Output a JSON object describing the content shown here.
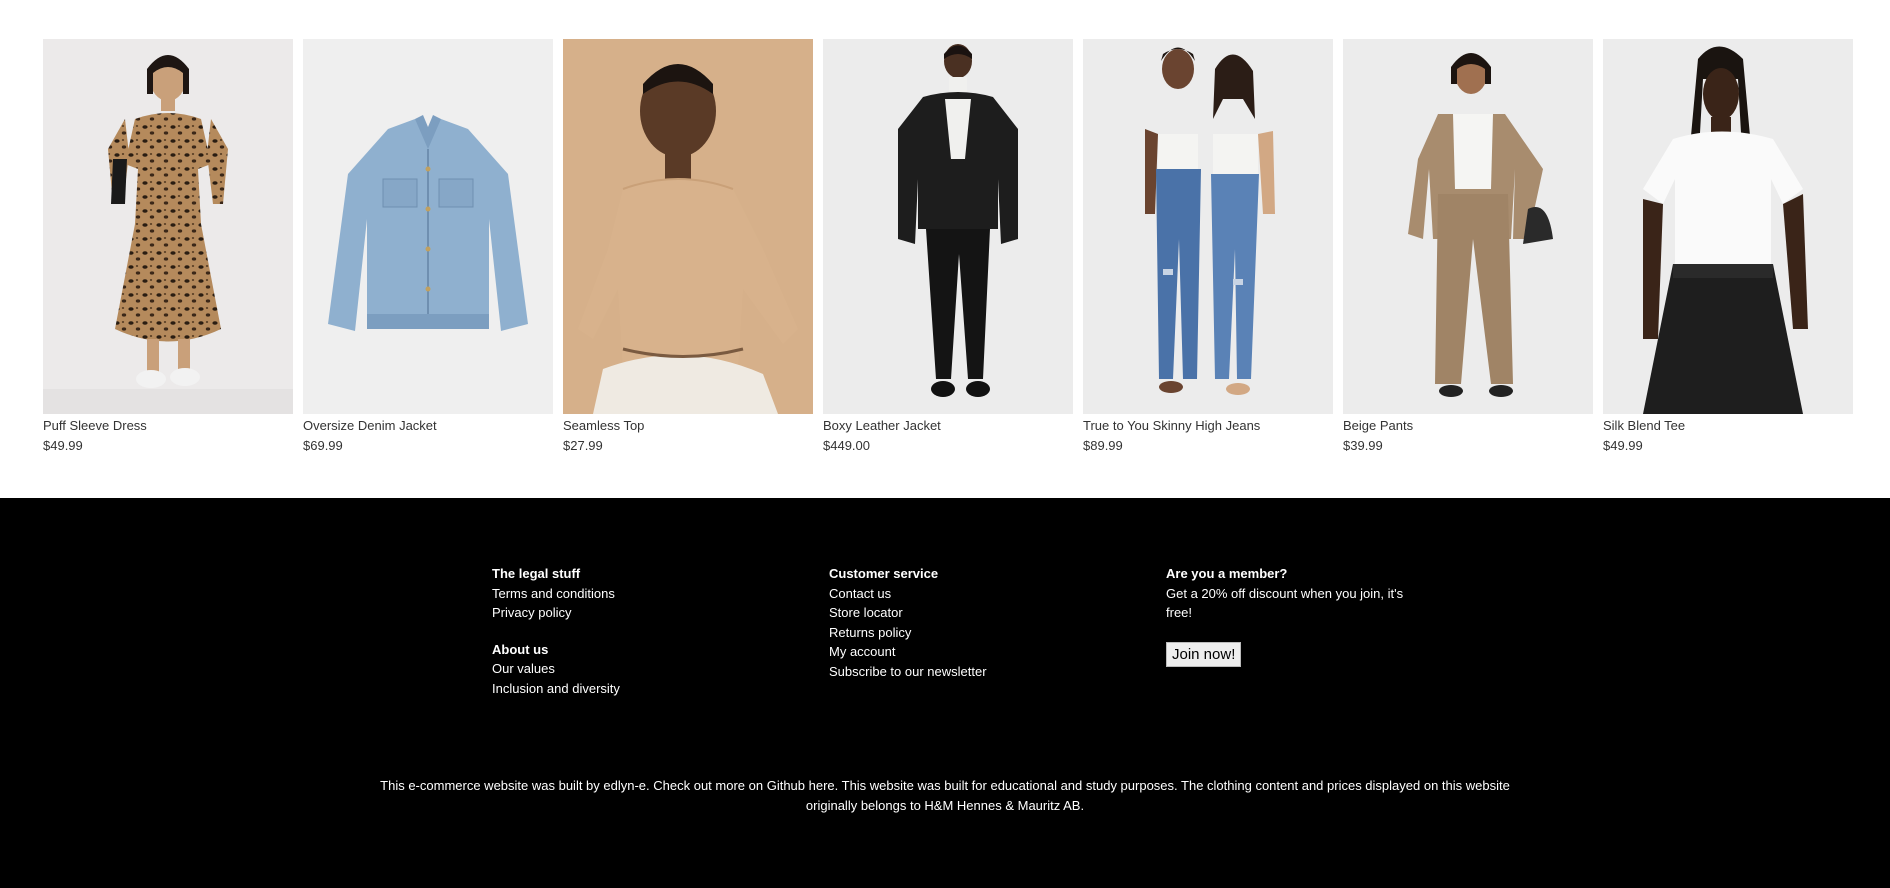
{
  "products": [
    {
      "name": "Puff Sleeve Dress",
      "price": "$49.99"
    },
    {
      "name": "Oversize Denim Jacket",
      "price": "$69.99"
    },
    {
      "name": "Seamless Top",
      "price": "$27.99"
    },
    {
      "name": "Boxy Leather Jacket",
      "price": "$449.00"
    },
    {
      "name": "True to You Skinny High Jeans",
      "price": "$89.99"
    },
    {
      "name": "Beige Pants",
      "price": "$39.99"
    },
    {
      "name": "Silk Blend Tee",
      "price": "$49.99"
    }
  ],
  "footer": {
    "legal": {
      "heading": "The legal stuff",
      "links": [
        "Terms and conditions",
        "Privacy policy"
      ]
    },
    "about": {
      "heading": "About us",
      "links": [
        "Our values",
        "Inclusion and diversity"
      ]
    },
    "service": {
      "heading": "Customer service",
      "links": [
        "Contact us",
        "Store locator",
        "Returns policy",
        "My account",
        "Subscribe to our newsletter"
      ]
    },
    "member": {
      "heading": "Are you a member?",
      "text": "Get a 20% off discount when you join, it's free!",
      "button": "Join now!"
    },
    "credit": "This e-commerce website was built by edlyn-e. Check out more on Github here. This website was built for educational and study purposes. The clothing content and prices displayed on this website originally belongs to H&M Hennes & Mauritz AB."
  },
  "colors": {
    "footer_bg": "#000000",
    "footer_text": "#ffffff",
    "page_bg": "#ffffff"
  }
}
